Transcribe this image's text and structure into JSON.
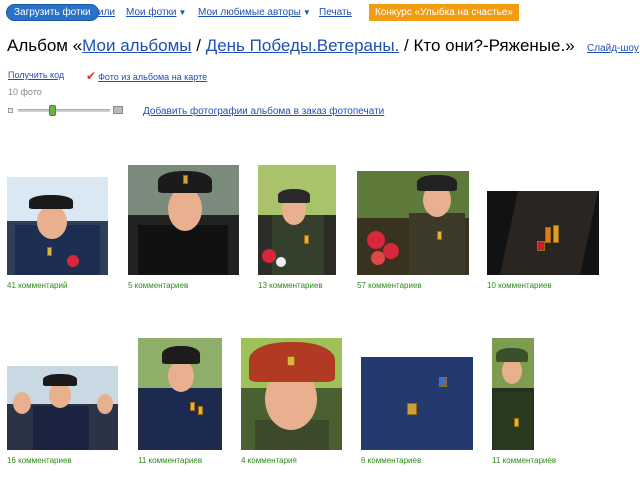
{
  "topbar": {
    "upload_label": "Загрузить фотки",
    "or_label": "или",
    "my_photos_label": "Мои фотки",
    "favorite_authors_label": "Мои любимые авторы",
    "print_label": "Печать",
    "contest_label": "Конкурс «Улыбка на счастье»"
  },
  "album": {
    "title_prefix": "Альбом «",
    "crumb_1": "Мои альбомы",
    "sep_1": " / ",
    "crumb_2": "День Победы.Ветераны.",
    "title_rest": " / Кто они?-Ряженые.»",
    "slideshow_label": "Слайд-шоу",
    "get_code_label": "Получить код",
    "map_label": "Фото из альбома на карте",
    "photo_count": "10 фото",
    "order_print_label": "Добавить фотографии альбома в заказ фотопечати",
    "zoom_level": 0.37
  },
  "photos": [
    {
      "comments": "41 комментарий"
    },
    {
      "comments": "5 комментариев"
    },
    {
      "comments": "13 комментариев"
    },
    {
      "comments": "57 комментариев"
    },
    {
      "comments": "10 комментариев"
    },
    {
      "comments": "16 комментариев"
    },
    {
      "comments": "11 комментариев"
    },
    {
      "comments": "4 комментария"
    },
    {
      "comments": "6 комментариев"
    },
    {
      "comments": "11 комментариев"
    }
  ],
  "colors": {
    "link": "#1f4fb5",
    "upload_button": "#2a72c7",
    "contest_badge": "#f39c11",
    "comment_text": "#2e8b1a"
  },
  "icons": [
    "chevron-down-icon",
    "red-checkmark-icon",
    "zoom-small-icon",
    "zoom-large-icon"
  ]
}
